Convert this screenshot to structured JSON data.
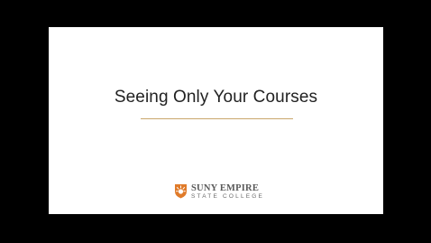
{
  "slide": {
    "title": "Seeing Only Your Courses"
  },
  "logo": {
    "line1": "SUNY EMPIRE",
    "line2": "STATE COLLEGE",
    "mark_icon": "sun-rays-shield-icon",
    "mark_color": "#e07b2a"
  },
  "colors": {
    "background": "#000000",
    "slide": "#ffffff",
    "rule": "#c9a66b",
    "title_text": "#222222"
  }
}
